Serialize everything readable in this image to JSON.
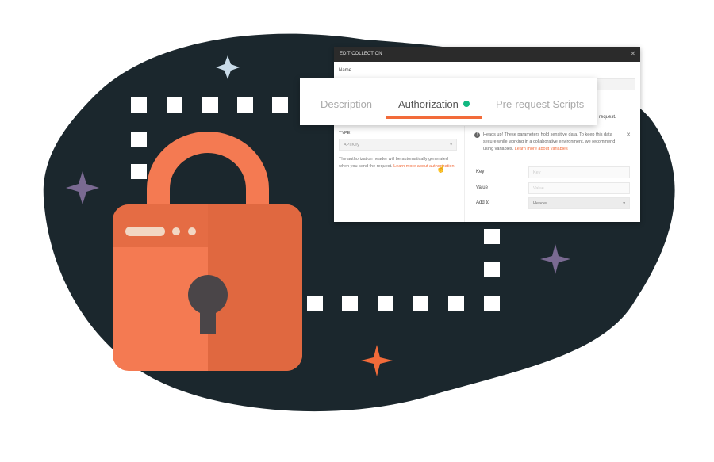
{
  "dialog": {
    "title": "EDIT COLLECTION",
    "close_icon": "close-icon",
    "name_label": "Name",
    "tabs": [
      {
        "label": "Description"
      },
      {
        "label": "Authorization",
        "active": true,
        "status": "green-dot"
      },
      {
        "label": "Pre-request Scripts"
      }
    ],
    "partial_text": "request.",
    "type_label": "TYPE",
    "type_value": "API Key",
    "help_text": "The authorization header will be automatically generated when you send the request.",
    "help_link": "Learn more about authorization",
    "notice": {
      "text": "Heads up! These parameters hold sensitive data. To keep this data secure while working in a collaborative environment, we recommend using variables.",
      "link": "Learn more about variables"
    },
    "fields": [
      {
        "label": "Key",
        "placeholder": "Key"
      },
      {
        "label": "Value",
        "placeholder": "Value"
      },
      {
        "label": "Add to",
        "value": "Header"
      }
    ]
  },
  "colors": {
    "blob": "#1b272d",
    "accent": "#f26b3a",
    "lock_light": "#f47a52",
    "lock_dark": "#e06840",
    "keyhole": "#4a4548"
  }
}
